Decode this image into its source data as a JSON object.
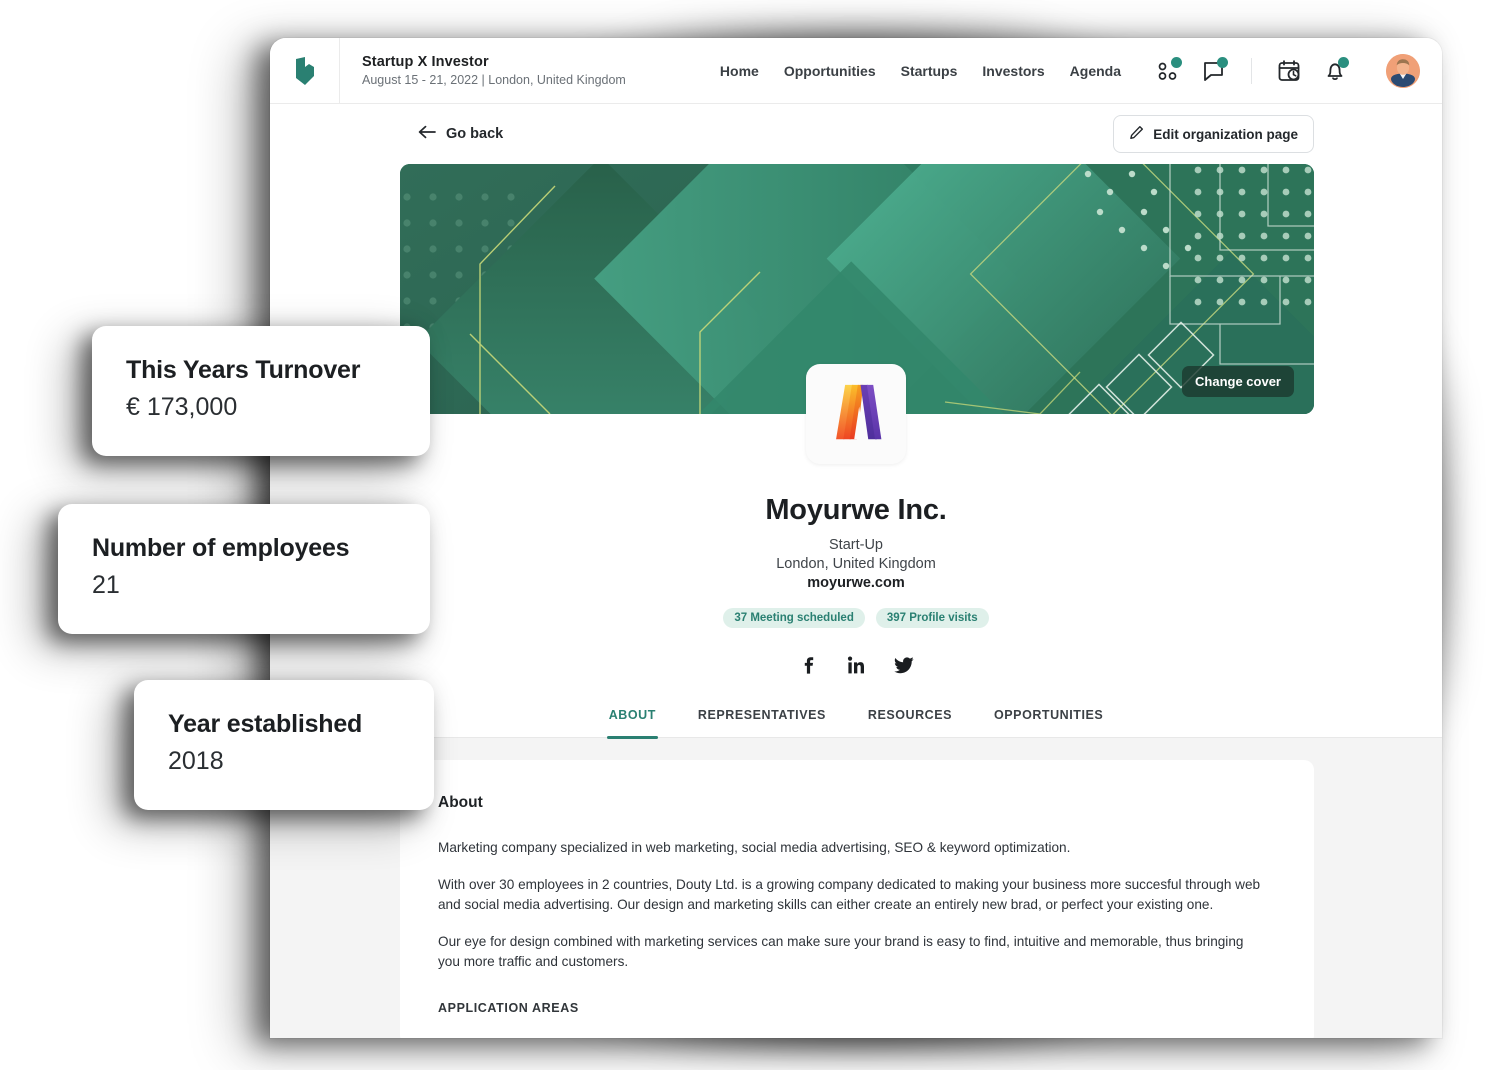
{
  "topbar": {
    "brand_icon": "leaf-logo-icon",
    "event_title": "Startup X Investor",
    "event_subtitle": "August 15 - 21, 2022 | London, United Kingdom",
    "nav_links": [
      {
        "label": "Home"
      },
      {
        "label": "Opportunities"
      },
      {
        "label": "Startups"
      },
      {
        "label": "Investors"
      },
      {
        "label": "Agenda"
      }
    ],
    "icons": [
      {
        "name": "matchmaking-icon",
        "badge": true
      },
      {
        "name": "chat-icon",
        "badge": true
      },
      {
        "name": "meeting-schedule-icon",
        "badge": false
      },
      {
        "name": "notification-bell-icon",
        "badge": true
      }
    ],
    "avatar_name": "user-avatar"
  },
  "action_row": {
    "go_back_label": "Go back",
    "go_back_icon": "arrow-left-icon",
    "edit_label": "Edit organization page",
    "edit_icon": "pencil-icon"
  },
  "cover": {
    "change_cover_label": "Change cover",
    "colors": {
      "base": "#2f7c62",
      "dark": "#255c4c",
      "mid": "#2e7a61",
      "light": "#3f9479",
      "lighter": "#4aa287",
      "line_yellow": "#c8d978",
      "line_white": "#d8e6dd",
      "dot": "#b6d7c6"
    }
  },
  "profile": {
    "logo_icon": "moyurwe-m-logo-icon",
    "name": "Moyurwe Inc.",
    "type": "Start-Up",
    "location": "London, United Kingdom",
    "website": "moyurwe.com",
    "badges": [
      {
        "label": "37 Meeting scheduled"
      },
      {
        "label": "397 Profile visits"
      }
    ],
    "badge_bg": "#dff0ea",
    "badge_fg": "#2a8072",
    "socials": [
      {
        "name": "facebook-icon"
      },
      {
        "name": "linkedin-icon"
      },
      {
        "name": "twitter-icon"
      }
    ]
  },
  "tabs": {
    "active_color": "#2a8072",
    "items": [
      {
        "label": "ABOUT",
        "active": true
      },
      {
        "label": "REPRESENTATIVES",
        "active": false
      },
      {
        "label": "RESOURCES",
        "active": false
      },
      {
        "label": "OPPORTUNITIES",
        "active": false
      }
    ]
  },
  "about": {
    "title": "About",
    "paragraphs": [
      "Marketing company specialized in web marketing, social media advertising, SEO & keyword optimization.",
      "With over 30 employees in 2 countries, Douty Ltd. is a growing company dedicated to making your business more succesful through web and social media advertising. Our design and marketing skills can either create an entirely new brad, or perfect your existing one.",
      "Our eye for design combined with marketing services can make sure your brand is easy to find, intuitive and memorable, thus bringing you more traffic and customers."
    ],
    "next_heading": "APPLICATION AREAS"
  },
  "stat_cards": [
    {
      "label": "This Years Turnover",
      "value": "€ 173,000"
    },
    {
      "label": "Number of employees",
      "value": "21"
    },
    {
      "label": "Year established",
      "value": "2018"
    }
  ]
}
